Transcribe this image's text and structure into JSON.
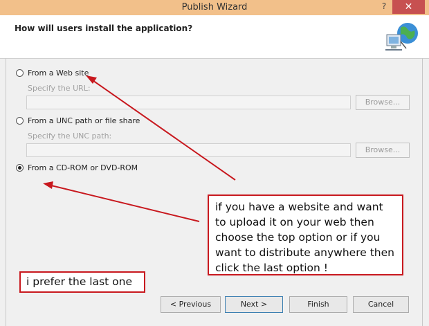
{
  "window": {
    "title": "Publish Wizard",
    "help_glyph": "?",
    "close_glyph": "✕"
  },
  "header": {
    "question": "How will users install the application?",
    "icon": "network-globe-icon"
  },
  "options": [
    {
      "label": "From a Web site",
      "sublabel": "Specify the URL:",
      "field_value": "",
      "browse_label": "Browse...",
      "selected": false
    },
    {
      "label": "From a UNC path or file share",
      "sublabel": "Specify the UNC path:",
      "field_value": "",
      "browse_label": "Browse...",
      "selected": false
    },
    {
      "label": "From a CD-ROM or DVD-ROM",
      "selected": true
    }
  ],
  "annotations": {
    "main_note": "if you have a website and want to upload it on your web then choose the top option or if you want to distribute anywhere then click the last option !",
    "small_note": "i prefer the last one",
    "color": "#c8181e"
  },
  "buttons": {
    "previous": "< Previous",
    "next": "Next >",
    "finish": "Finish",
    "cancel": "Cancel"
  }
}
